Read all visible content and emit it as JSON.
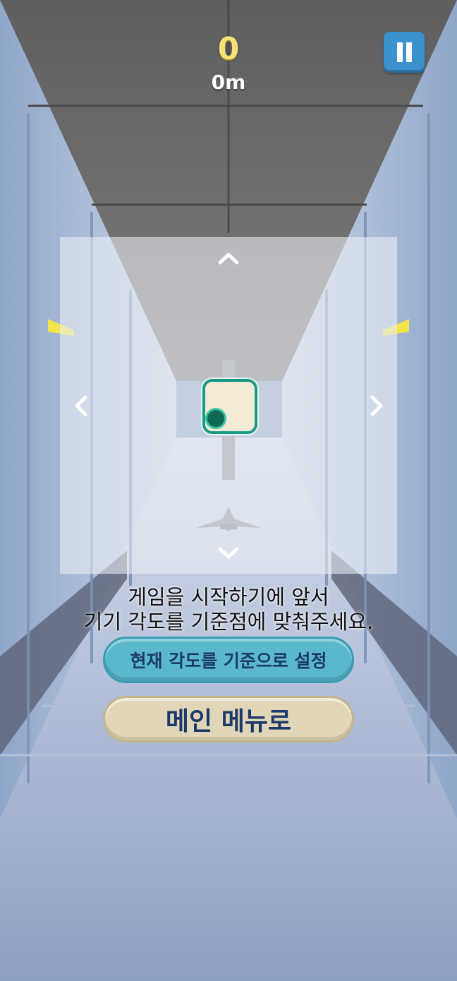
{
  "hud": {
    "score": "0",
    "distance": "0m"
  },
  "calibration": {
    "instruction_line1": "게임을 시작하기에 앞서",
    "instruction_line2": "기기 각도를 기준점에 맞춰주세요."
  },
  "buttons": {
    "set_baseline": "현재 각도를 기준으로 설정",
    "main_menu": "메인 메뉴로"
  },
  "icons": {
    "pause": "pause-icon",
    "up": "chevron-up-icon",
    "down": "chevron-down-icon",
    "left": "chevron-left-icon",
    "right": "chevron-right-icon"
  },
  "colors": {
    "score": "#f7e27a",
    "pause_button": "#3b92cf",
    "target_border": "#1a9a86",
    "target_fill": "#f4ebd6",
    "tilt_dot": "#0f6b55",
    "baseline_button": "#59b8cc",
    "menu_button": "#e1d6b7",
    "button_text": "#1c3a6b"
  }
}
